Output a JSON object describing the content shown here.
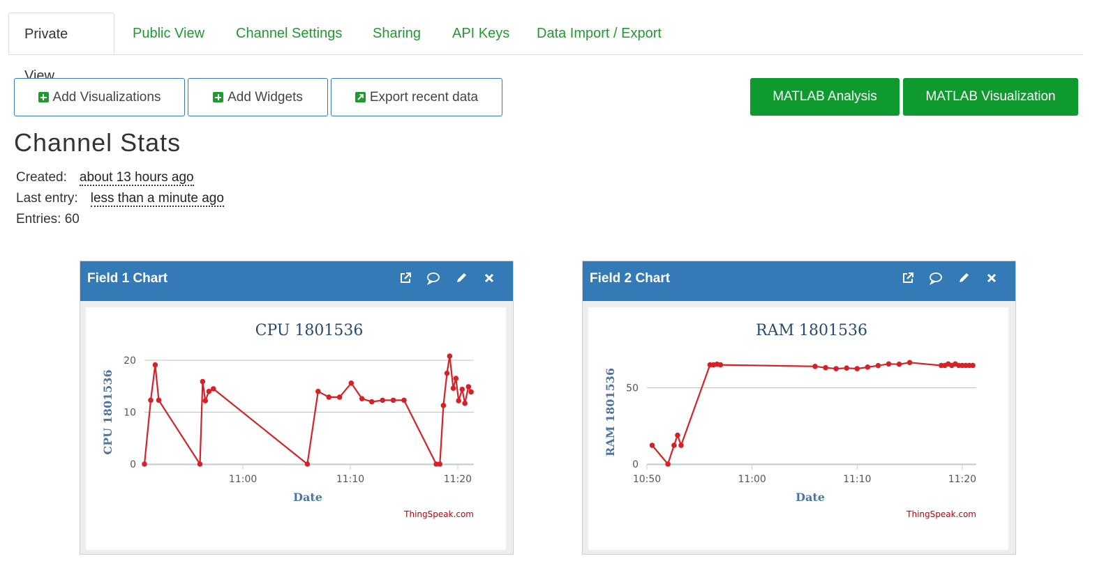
{
  "tabs": [
    {
      "label": "Private View",
      "active": true
    },
    {
      "label": "Public View",
      "active": false
    },
    {
      "label": "Channel Settings",
      "active": false
    },
    {
      "label": "Sharing",
      "active": false
    },
    {
      "label": "API Keys",
      "active": false
    },
    {
      "label": "Data Import / Export",
      "active": false
    }
  ],
  "toolbar": {
    "add_visualizations": "Add Visualizations",
    "add_widgets": "Add Widgets",
    "export_recent": "Export recent data",
    "matlab_analysis": "MATLAB Analysis",
    "matlab_visualization": "MATLAB Visualization"
  },
  "stats": {
    "title": "Channel Stats",
    "created_label": "Created:",
    "created_value": "about 13 hours ago",
    "last_entry_label": "Last entry:",
    "last_entry_value": "less than a minute ago",
    "entries_text": "Entries: 60"
  },
  "colors": {
    "accent": "#337ab7",
    "green": "#1e9a2e",
    "line": "#d62226"
  },
  "panels": [
    {
      "title": "Field 1 Chart",
      "icons": [
        "external-link-icon",
        "comment-icon",
        "pencil-icon",
        "close-icon"
      ]
    },
    {
      "title": "Field 2 Chart",
      "icons": [
        "external-link-icon",
        "comment-icon",
        "pencil-icon",
        "close-icon"
      ]
    }
  ],
  "chart_data": [
    {
      "type": "line",
      "title": "CPU 1801536",
      "xlabel": "Date",
      "ylabel": "CPU 1801536",
      "credit": "ThingSpeak.com",
      "xlim": [
        "10:50:50",
        "11:21:30"
      ],
      "ylim": [
        0,
        20
      ],
      "yticks": [
        0,
        10,
        20
      ],
      "xticks": [
        "11:00",
        "11:10",
        "11:20"
      ],
      "grid": true,
      "series": [
        {
          "x": [
            "10:50:50",
            "10:51:25",
            "10:51:50",
            "10:52:10",
            "10:56:00",
            "10:56:15",
            "10:56:30",
            "10:56:50",
            "10:57:15",
            "11:06:00",
            "11:07:00",
            "11:08:00",
            "11:09:00",
            "11:10:05",
            "11:11:05",
            "11:12:00",
            "11:13:00",
            "11:14:00",
            "11:15:00",
            "11:18:00",
            "11:18:20",
            "11:18:40",
            "11:19:00",
            "11:19:15",
            "11:19:35",
            "11:19:50",
            "11:20:05",
            "11:20:25",
            "11:20:40",
            "11:21:00",
            "11:21:15"
          ],
          "values": [
            0,
            12.3,
            19.1,
            12.3,
            0,
            15.9,
            12.2,
            14.0,
            14.5,
            0,
            14.0,
            12.9,
            12.9,
            15.6,
            12.6,
            12.0,
            12.3,
            12.3,
            12.3,
            0,
            0,
            11.3,
            17.5,
            20.8,
            14.6,
            16.5,
            12.2,
            14.4,
            11.7,
            14.9,
            13.9
          ]
        }
      ]
    },
    {
      "type": "line",
      "title": "RAM 1801536",
      "xlabel": "Date",
      "ylabel": "RAM 1801536",
      "credit": "ThingSpeak.com",
      "xlim": [
        "10:50:00",
        "11:21:20"
      ],
      "ylim": [
        0,
        68
      ],
      "yticks": [
        0,
        50
      ],
      "xticks": [
        "10:50",
        "11:00",
        "11:10",
        "11:20"
      ],
      "grid": true,
      "series": [
        {
          "x": [
            "10:50:30",
            "10:52:00",
            "10:52:35",
            "10:52:55",
            "10:53:15",
            "10:56:00",
            "10:56:20",
            "10:56:40",
            "10:57:00",
            "11:06:00",
            "11:07:00",
            "11:08:00",
            "11:09:00",
            "11:10:00",
            "11:11:00",
            "11:12:00",
            "11:13:00",
            "11:14:00",
            "11:15:00",
            "11:18:00",
            "11:18:20",
            "11:18:40",
            "11:19:00",
            "11:19:20",
            "11:19:40",
            "11:20:00",
            "11:20:20",
            "11:20:40",
            "11:21:00"
          ],
          "values": [
            12.3,
            0,
            12.3,
            18.9,
            12.3,
            65,
            65,
            65.4,
            65,
            64,
            63.1,
            62.5,
            62.9,
            62.5,
            63.5,
            64.5,
            65.6,
            65.4,
            66.5,
            64.6,
            64.6,
            65.6,
            64.6,
            65.6,
            64.6,
            64.6,
            64.6,
            64.6,
            64.6
          ]
        }
      ]
    }
  ]
}
